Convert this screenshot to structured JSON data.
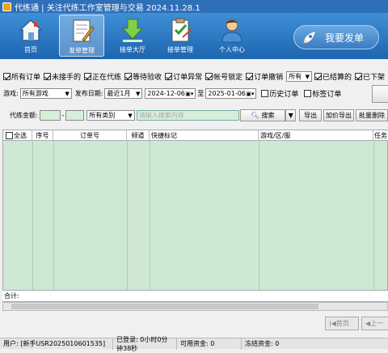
{
  "window": {
    "title": "代练通 | 关注代练工作室管理与交易 2024.11.28.1"
  },
  "nav": [
    {
      "label": "首页",
      "icon": "home-icon"
    },
    {
      "label": "发单管理",
      "icon": "notebook-pen-icon"
    },
    {
      "label": "接单大厅",
      "icon": "download-arrow-icon"
    },
    {
      "label": "接单管理",
      "icon": "clipboard-check-icon"
    },
    {
      "label": "个人中心",
      "icon": "person-icon"
    }
  ],
  "publish_button": "我要发单",
  "filters": {
    "checkboxes": [
      {
        "label": "所有订单",
        "checked": true
      },
      {
        "label": "未接手的",
        "checked": true
      },
      {
        "label": "正在代练",
        "checked": true
      },
      {
        "label": "等待验收",
        "checked": true
      },
      {
        "label": "订单异常",
        "checked": true
      },
      {
        "label": "帐号锁定",
        "checked": true
      },
      {
        "label": "订单撤销",
        "checked": true
      }
    ],
    "status_select": "所有",
    "checkboxes_right": [
      {
        "label": "已结算的",
        "checked": true
      },
      {
        "label": "已下架",
        "checked": true
      }
    ],
    "game_label": "游戏:",
    "game_value": "所有游戏",
    "date_label": "发布日期:",
    "date_range": "最近1月",
    "date_from": "2024-12-06",
    "to_label": "至",
    "date_to": "2025-01-06",
    "history_label": "历史订单",
    "tag_label": "标签订单",
    "amount_label": "代练金额:",
    "amount_dash": "-",
    "category_value": "所有类别",
    "search_placeholder": "请输入搜索内容",
    "search_button": "搜索",
    "export_button": "导出",
    "price_export_button": "加价导出",
    "batch_button": "批量删除"
  },
  "table": {
    "columns": [
      "全选",
      "序号",
      "订单号",
      "频道",
      "快捷标记",
      "游戏/区/服",
      "任务"
    ],
    "select_all_checked": false,
    "summary_label": "合计:"
  },
  "pager": {
    "first": "首页",
    "prev": "上一"
  },
  "status": {
    "user": "用户: [新手USR2025010601535]",
    "logged": "已登录: 0小时0分钟38秒",
    "funds": "可用资金: 0",
    "frozen": "冻结资金: 0"
  }
}
